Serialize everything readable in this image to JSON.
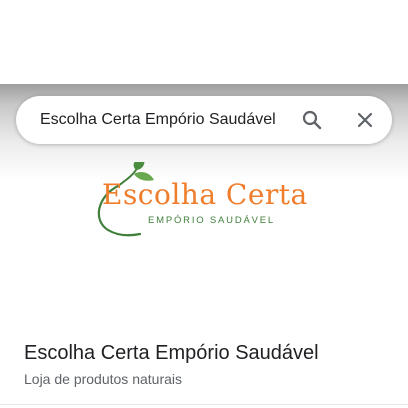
{
  "search": {
    "query": "Escolha Certa Empório Saudável"
  },
  "logo": {
    "title": "Escolha Certa",
    "subtitle": "EMPÓRIO SAUDÁVEL",
    "title_color": "#ef7d2c",
    "accent_color": "#3f7f3a"
  },
  "place": {
    "name": "Escolha Certa Empório Saudável",
    "category": "Loja de produtos naturais"
  },
  "icons": {
    "search": "search-icon",
    "close": "close-icon",
    "leaf": "leaf-icon"
  }
}
